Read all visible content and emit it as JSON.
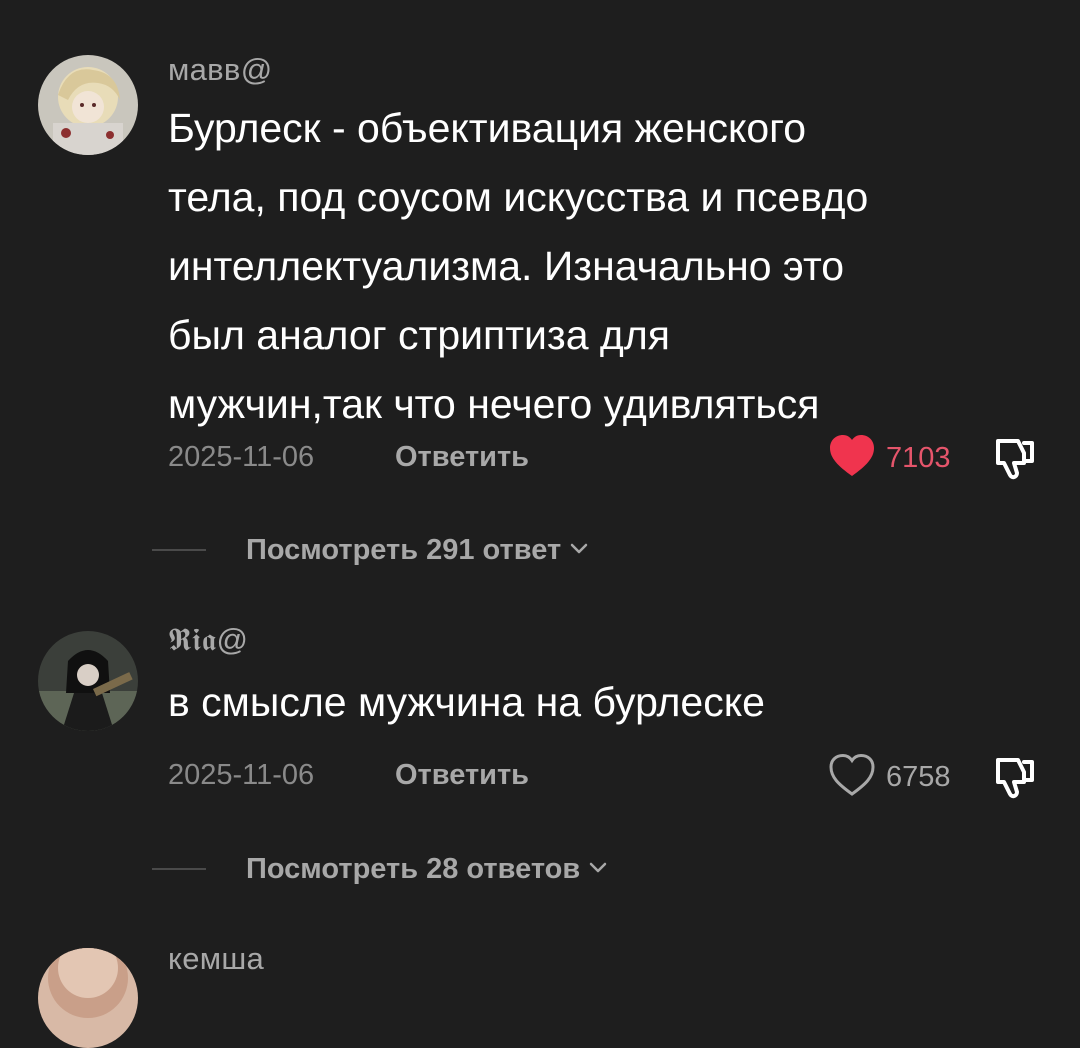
{
  "comments": [
    {
      "username": "мавв@",
      "text_lines": [
        "Бурлеск - объективация женского",
        "тела, под соусом искусства и псевдо",
        "интеллектуализма. Изначально это",
        "был аналог стриптиза для",
        "мужчин,так что нечего удивляться"
      ],
      "date": "2025-11-06",
      "reply_label": "Ответить",
      "likes": "7103",
      "liked": true,
      "view_replies_label": "Посмотреть 291 ответ"
    },
    {
      "username": "𝕽𝖎𝖆@",
      "text_lines": [
        "в смысле мужчина на бурлеске"
      ],
      "date": "2025-11-06",
      "reply_label": "Ответить",
      "likes": "6758",
      "liked": false,
      "view_replies_label": "Посмотреть 28 ответов"
    },
    {
      "username": "кемша"
    }
  ],
  "colors": {
    "background": "#1e1e1e",
    "liked_heart": "#f0344e",
    "liked_count": "#e5556b",
    "muted_text": "#a8a8a8"
  },
  "icons": {
    "like": "heart-icon",
    "dislike": "thumbs-down-icon",
    "expand": "chevron-down-icon"
  }
}
